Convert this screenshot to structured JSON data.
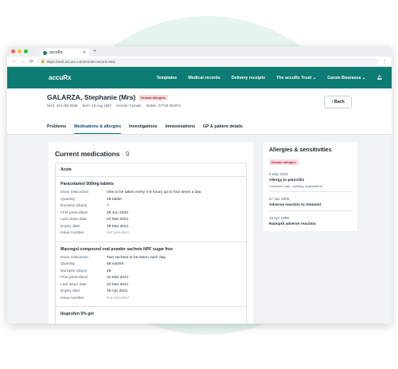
{
  "browser": {
    "tab_title": "accuRx",
    "url": "https://web.accurx.com/remote-record-view"
  },
  "app": {
    "brand": "accuRx",
    "nav": [
      "Templates",
      "Medical records",
      "Delivery receipts",
      "The accuRx Trust",
      "Carole Bourassa"
    ]
  },
  "patient": {
    "name": "GALARZA, Stephanie (Mrs)",
    "badge": "Known allergies",
    "nhs": "NHS: 444 456 2538",
    "born": "Born: 19 Aug 1957",
    "gender": "Gender: Female",
    "mobile": "Mobile: 07729 292071",
    "back_label": "Back",
    "tabs": [
      "Problems",
      "Medications & allergies",
      "Investigations",
      "Immunisations",
      "GP & patient details"
    ]
  },
  "medications": {
    "title": "Current medications",
    "count": "· 9",
    "section": "Acute",
    "drugs": [
      {
        "name": "Paracetamol 500mg tablets",
        "rows": [
          [
            "Dose instruction",
            "One to be taken every 4-6 hours up to four times a day"
          ],
          [
            "Quantity",
            "28 tablet"
          ],
          [
            "Duration (days)",
            "7"
          ],
          [
            "First prescribed",
            "25 Jun 2020"
          ],
          [
            "Last issue date",
            "22 Mar 2021"
          ],
          [
            "Expiry date",
            "29 Mar 2021"
          ],
          [
            "Issue number",
            "Not provided"
          ]
        ]
      },
      {
        "name": "Macrogol compound oral powder sachets NPF sugar free",
        "rows": [
          [
            "Dose instruction",
            "Two sachets to be taken each day"
          ],
          [
            "Quantity",
            "56 sachet"
          ],
          [
            "Duration (days)",
            "28"
          ],
          [
            "First prescribed",
            "22 Mar 2021"
          ],
          [
            "Last issue date",
            "22 Mar 2021"
          ],
          [
            "Expiry date",
            "19 Apr 2021"
          ],
          [
            "Issue number",
            "Not provided"
          ]
        ]
      },
      {
        "name": "Ibuprofen 5% gel",
        "rows": []
      }
    ]
  },
  "allergies": {
    "title": "Allergies & sensitivities",
    "badge": "Known allergies",
    "entries": [
      {
        "date": "5 May 2020",
        "name": "Allergy to penicillin",
        "comment": "Comment: rash, vomiting, angioedema"
      },
      {
        "date": "27 Jan 2005",
        "name": "Adverse reaction to Atenolol",
        "comment": ""
      },
      {
        "date": "19 Apr 1999",
        "name": "Ramipril adverse reaction",
        "comment": ""
      }
    ]
  }
}
